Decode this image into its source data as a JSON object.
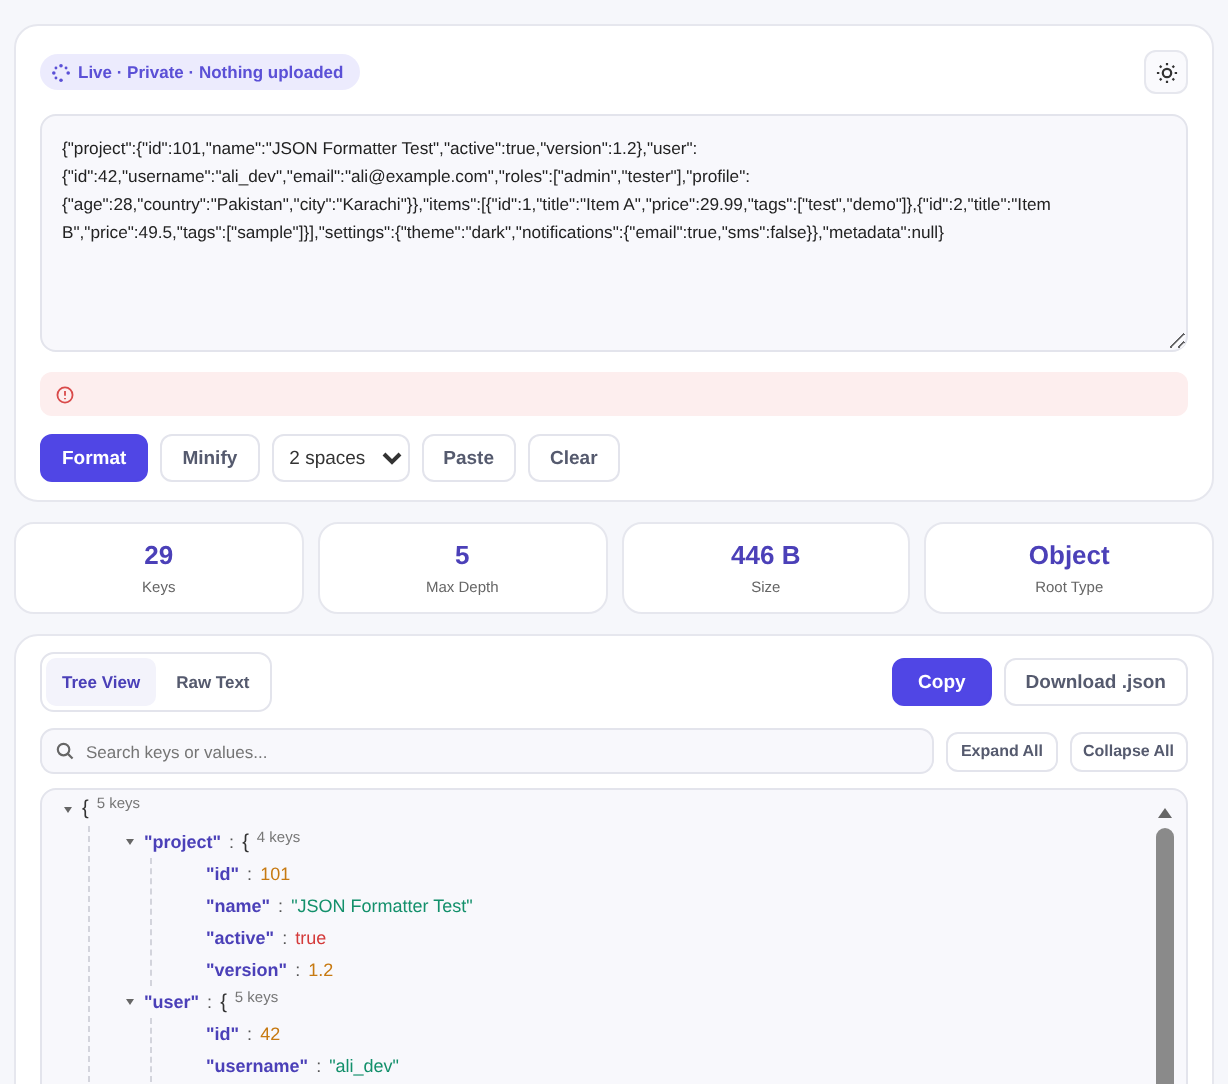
{
  "editor": {
    "badge": "Live · Private · Nothing uploaded",
    "input": "{\"project\":{\"id\":101,\"name\":\"JSON Formatter Test\",\"active\":true,\"version\":1.2},\"user\":{\"id\":42,\"username\":\"ali_dev\",\"email\":\"ali@example.com\",\"roles\":[\"admin\",\"tester\"],\"profile\":{\"age\":28,\"country\":\"Pakistan\",\"city\":\"Karachi\"}},\"items\":[{\"id\":1,\"title\":\"Item A\",\"price\":29.99,\"tags\":[\"test\",\"demo\"]},{\"id\":2,\"title\":\"Item B\",\"price\":49.5,\"tags\":[\"sample\"]}],\"settings\":{\"theme\":\"dark\",\"notifications\":{\"email\":true,\"sms\":false}},\"metadata\":null}",
    "buttons": [
      {
        "label": "Format",
        "primary": true
      },
      {
        "label": "Minify",
        "primary": false
      }
    ],
    "indent": "2 spaces",
    "buttons_after": [
      {
        "label": "Paste"
      },
      {
        "label": "Clear"
      }
    ]
  },
  "stats": [
    {
      "value": "29",
      "label": "Keys"
    },
    {
      "value": "5",
      "label": "Max Depth"
    },
    {
      "value": "446 B",
      "label": "Size"
    },
    {
      "value": "Object",
      "label": "Root Type"
    }
  ],
  "viewer": {
    "tabs": [
      {
        "label": "Tree View",
        "selected": true
      },
      {
        "label": "Raw Text",
        "selected": false
      }
    ],
    "copy": "Copy",
    "download": "Download .json",
    "search": {
      "placeholder": "Search keys or values..."
    },
    "expand_all": "Expand All",
    "collapse_all": "Collapse All",
    "separator": ":",
    "tree": {
      "brace": "{",
      "summary": "5 keys",
      "expanded": true,
      "children": [
        {
          "key": "\"project\"",
          "brace": "{",
          "summary": "4 keys",
          "expanded": true,
          "children": [
            {
              "key": "\"id\"",
              "value": "101",
              "kind": "number"
            },
            {
              "key": "\"name\"",
              "value": "\"JSON Formatter Test\"",
              "kind": "string"
            },
            {
              "key": "\"active\"",
              "value": "true",
              "kind": "boolean"
            },
            {
              "key": "\"version\"",
              "value": "1.2",
              "kind": "number"
            }
          ]
        },
        {
          "key": "\"user\"",
          "brace": "{",
          "summary": "5 keys",
          "expanded": true,
          "children": [
            {
              "key": "\"id\"",
              "value": "42",
              "kind": "number"
            },
            {
              "key": "\"username\"",
              "value": "\"ali_dev\"",
              "kind": "string"
            }
          ]
        }
      ]
    }
  }
}
